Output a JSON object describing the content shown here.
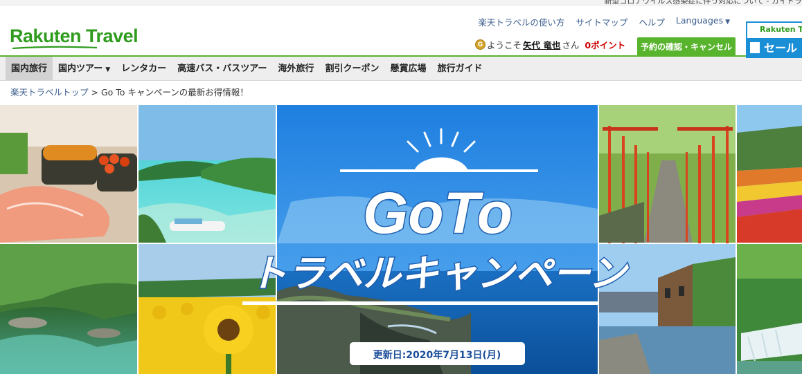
{
  "topstrip": {
    "text": "新型コロナウイルス感染症に伴う対応について - ガイドラ"
  },
  "header": {
    "logo": "Rakuten Travel",
    "util_links": [
      {
        "label": "楽天トラベルの使い方"
      },
      {
        "label": "サイトマップ"
      },
      {
        "label": "ヘルプ"
      },
      {
        "label": "Languages"
      }
    ],
    "account": {
      "coin": "G",
      "welcome": "ようこそ",
      "user_name": "矢代 竜也",
      "honorific": "さん",
      "points": "0ポイント"
    },
    "confirm_button": "予約の確認・キャンセル",
    "sale_banner": {
      "top": "Rakuten Tra",
      "bottom": "セール"
    }
  },
  "nav": {
    "items": [
      {
        "label": "国内旅行"
      },
      {
        "label": "国内ツアー"
      },
      {
        "label": "レンタカー"
      },
      {
        "label": "高速バス・バスツアー"
      },
      {
        "label": "海外旅行"
      },
      {
        "label": "割引クーポン"
      },
      {
        "label": "懸賞広場"
      },
      {
        "label": "旅行ガイド"
      }
    ]
  },
  "breadcrumb": {
    "home": "楽天トラベルトップ",
    "separator": ">",
    "current": "Go To キャンペーンの最新お得情報！"
  },
  "hero": {
    "title_line1": "GoTo",
    "title_line2": "トラベルキャンペーン",
    "updated": "更新日:2020年7月13日(月)",
    "colors": {
      "title": "#ffffff",
      "title_shadow": "#1e5fae",
      "sky": "#2d8be0",
      "sea": "#0f5aa8"
    }
  }
}
